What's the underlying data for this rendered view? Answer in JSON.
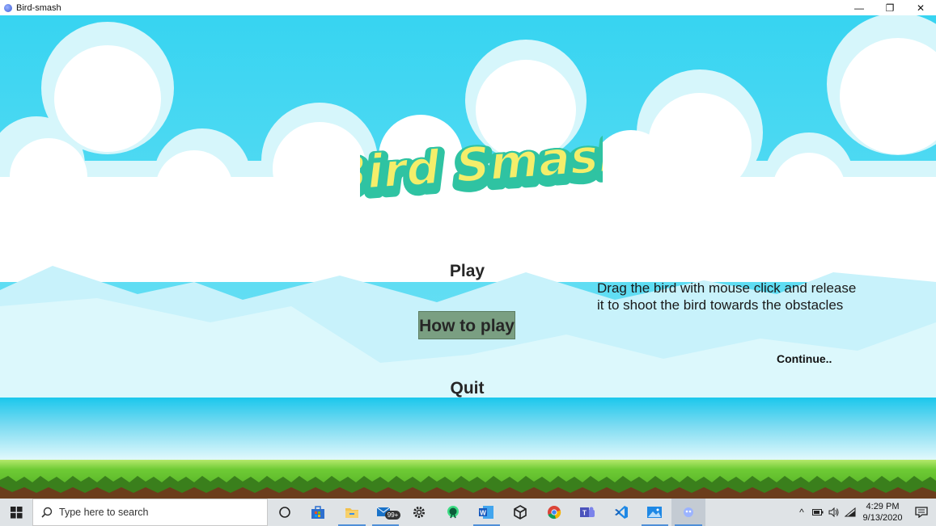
{
  "window": {
    "title": "Bird-smash",
    "minimize_glyph": "—",
    "restore_glyph": "❐",
    "close_glyph": "✕"
  },
  "game": {
    "logo_text": "Bird Smash",
    "menu": {
      "play": "Play",
      "how_to_play": "How to play",
      "quit": "Quit"
    },
    "instructions": {
      "text": "Drag the bird with mouse click and release it to shoot the bird towards the obstacles",
      "continue": "Continue.."
    },
    "colors": {
      "sky": "#3fd4ee",
      "cloud": "#ffffff",
      "highlight_button": "#7a9f82",
      "grass": "#58b82a",
      "logo_fill": "#f4ee6a",
      "logo_outline": "#2fc3a2"
    }
  },
  "taskbar": {
    "search_placeholder": "Type here to search",
    "mail_badge": "99+",
    "apps": [
      {
        "name": "cortana-icon"
      },
      {
        "name": "store-icon"
      },
      {
        "name": "file-explorer-icon"
      },
      {
        "name": "mail-icon"
      },
      {
        "name": "settings-icon"
      },
      {
        "name": "android-studio-icon"
      },
      {
        "name": "word-icon"
      },
      {
        "name": "unity-icon"
      },
      {
        "name": "chrome-icon"
      },
      {
        "name": "teams-icon"
      },
      {
        "name": "vscode-icon"
      },
      {
        "name": "photos-icon"
      },
      {
        "name": "bird-smash-app-icon"
      }
    ],
    "clock": {
      "time": "4:29 PM",
      "date": "9/13/2020"
    }
  }
}
